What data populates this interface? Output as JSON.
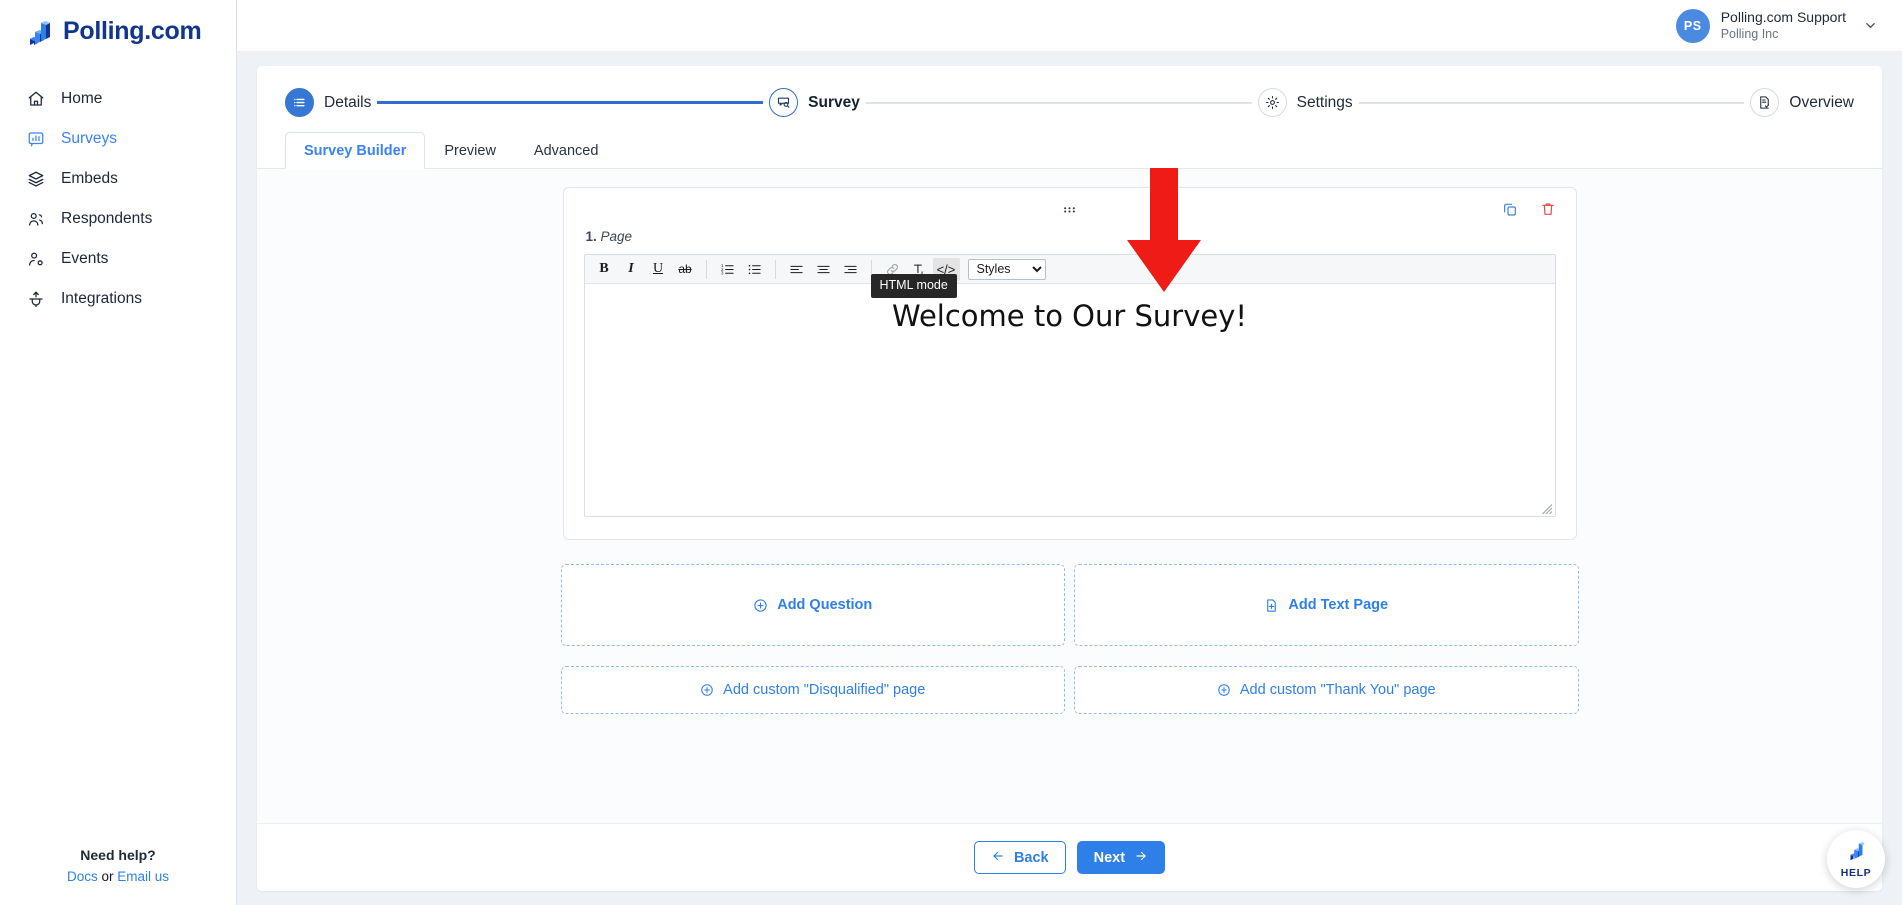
{
  "brand": {
    "name": "Polling.com",
    "logo_icon": "polling-bar-logo-icon"
  },
  "sidebar": {
    "items": [
      {
        "label": "Home",
        "icon": "home-icon",
        "active": false
      },
      {
        "label": "Surveys",
        "icon": "survey-chart-icon",
        "active": true
      },
      {
        "label": "Embeds",
        "icon": "layers-icon",
        "active": false
      },
      {
        "label": "Respondents",
        "icon": "users-icon",
        "active": false
      },
      {
        "label": "Events",
        "icon": "user-gear-icon",
        "active": false
      },
      {
        "label": "Integrations",
        "icon": "plug-upload-icon",
        "active": false
      }
    ],
    "help": {
      "title": "Need help?",
      "docs_label": "Docs",
      "separator": "or",
      "email_label": "Email us"
    }
  },
  "topbar": {
    "user": {
      "initials": "PS",
      "name": "Polling.com Support",
      "org": "Polling Inc",
      "caret_icon": "chevron-down-icon"
    }
  },
  "stepper": {
    "steps": [
      {
        "label": "Details",
        "icon": "list-icon",
        "state": "done"
      },
      {
        "label": "Survey",
        "icon": "survey-search-icon",
        "state": "current"
      },
      {
        "label": "Settings",
        "icon": "gear-icon",
        "state": "upcoming"
      },
      {
        "label": "Overview",
        "icon": "document-check-icon",
        "state": "upcoming"
      }
    ]
  },
  "tabs": [
    {
      "label": "Survey Builder",
      "active": true
    },
    {
      "label": "Preview",
      "active": false
    },
    {
      "label": "Advanced",
      "active": false
    }
  ],
  "page_card": {
    "drag_handle_icon": "drag-dots-icon",
    "duplicate_icon": "copy-icon",
    "delete_icon": "trash-icon",
    "number": "1.",
    "label": "Page"
  },
  "editor": {
    "toolbar": [
      {
        "name": "bold",
        "glyph": "B",
        "icon": "bold-icon",
        "active": false
      },
      {
        "name": "italic",
        "glyph": "I",
        "icon": "italic-icon",
        "active": false
      },
      {
        "name": "underline",
        "glyph": "U",
        "icon": "underline-icon",
        "active": false
      },
      {
        "name": "strikethrough",
        "glyph": "ab",
        "icon": "strikethrough-icon",
        "active": false
      },
      {
        "name": "numbered-list",
        "glyph": "",
        "icon": "ordered-list-icon",
        "active": false
      },
      {
        "name": "bulleted-list",
        "glyph": "",
        "icon": "unordered-list-icon",
        "active": false
      },
      {
        "name": "align-left",
        "glyph": "",
        "icon": "align-left-icon",
        "active": false
      },
      {
        "name": "align-center",
        "glyph": "",
        "icon": "align-center-icon",
        "active": false
      },
      {
        "name": "align-right",
        "glyph": "",
        "icon": "align-right-icon",
        "active": false
      },
      {
        "name": "link",
        "glyph": "",
        "icon": "link-icon",
        "active": false
      },
      {
        "name": "remove-format",
        "glyph": "",
        "icon": "clear-format-icon",
        "active": false
      },
      {
        "name": "html-mode",
        "glyph": "</>",
        "icon": "code-icon",
        "active": true
      }
    ],
    "styles_select": {
      "value": "Styles",
      "options": [
        "Styles"
      ]
    },
    "content_heading": "Welcome to Our Survey!",
    "tooltip": "HTML mode",
    "resize_icon": "resize-grip-icon"
  },
  "add_buttons": {
    "row1": [
      {
        "label": "Add Question",
        "icon": "plus-circle-icon"
      },
      {
        "label": "Add Text Page",
        "icon": "file-plus-icon"
      }
    ],
    "row2": [
      {
        "label": "Add custom \"Disqualified\" page",
        "icon": "plus-circle-icon"
      },
      {
        "label": "Add custom \"Thank You\" page",
        "icon": "plus-circle-icon"
      }
    ]
  },
  "footer": {
    "back_label": "Back",
    "back_icon": "arrow-left-icon",
    "next_label": "Next",
    "next_icon": "arrow-right-icon"
  },
  "help_fab": {
    "label": "HELP",
    "icon": "polling-bar-logo-icon"
  },
  "annotation": {
    "type": "red-down-arrow",
    "color": "#ef1b17"
  },
  "colors": {
    "brand_navy": "#12358f",
    "accent_blue": "#2f7fe8",
    "link_blue": "#3b82f6",
    "step_blue": "#3477d4",
    "danger_red": "#e24a45",
    "annotation_red": "#ef1b17",
    "page_bg": "#eef1f5"
  }
}
